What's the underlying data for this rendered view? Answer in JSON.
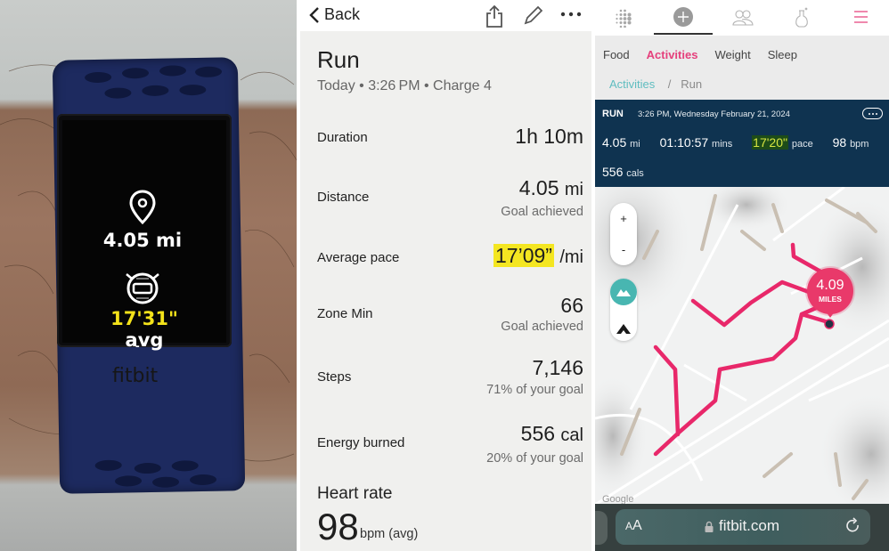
{
  "tracker": {
    "distance": "4.05 mi",
    "pace_value": "17'31\"",
    "pace_suffix": "avg",
    "dash": "-",
    "brand": "fitbit",
    "pace_color": "#f3e21a"
  },
  "app": {
    "nav": {
      "back_label": "Back",
      "icons": [
        "share-icon",
        "edit-pencil-icon",
        "more-icon"
      ]
    },
    "title": "Run",
    "subtitle": "Today • 3:26 PM • Charge 4",
    "stats": [
      {
        "label": "Duration",
        "value": "1h 10m",
        "note": ""
      },
      {
        "label": "Distance",
        "value": "4.05",
        "unit": "mi",
        "note": "Goal achieved"
      },
      {
        "label": "Average pace",
        "value": "17’09”",
        "unit": "/mi",
        "note": ""
      },
      {
        "label": "Zone Min",
        "value": "66",
        "note": "Goal achieved"
      },
      {
        "label": "Steps",
        "value": "7,146",
        "note": "71% of your goal"
      },
      {
        "label": "Energy burned",
        "value": "556",
        "unit": "cal",
        "note": "20% of your goal"
      }
    ],
    "heart_rate": {
      "title": "Heart rate",
      "value": "98",
      "unit": "bpm (avg)"
    },
    "highlight_color": "#f4e621"
  },
  "web": {
    "top_nav_icons": [
      "fitbit-logo-icon",
      "add-icon",
      "friends-icon",
      "labs-flask-icon",
      "menu-icon"
    ],
    "category_tabs": [
      {
        "label": "Food",
        "active": false
      },
      {
        "label": "Activities",
        "active": true
      },
      {
        "label": "Weight",
        "active": false
      },
      {
        "label": "Sleep",
        "active": false
      }
    ],
    "breadcrumb": {
      "parent": "Activities",
      "separator": "/",
      "current": "Run"
    },
    "run": {
      "type": "RUN",
      "datetime": "3:26 PM, Wednesday February 21, 2024",
      "distance_value": "4.05",
      "distance_unit": "mi",
      "duration_value": "01:10:57",
      "duration_unit": "mins",
      "pace_value": "17'20\"",
      "pace_unit": "pace",
      "hr_value": "98",
      "hr_unit": "bpm",
      "cal_value": "556",
      "cal_unit": "cals"
    },
    "map": {
      "zoom_in": "+",
      "zoom_out": "-",
      "badge_value": "4.09",
      "badge_unit": "MILES",
      "attribution": "Google",
      "route_color": "#e8286a",
      "accent_color": "#e5407c",
      "teal_color": "#48b6b1"
    },
    "browser": {
      "aa_small": "A",
      "aa_large": "A",
      "url": "fitbit.com"
    },
    "panel_color": "#0f3350"
  }
}
